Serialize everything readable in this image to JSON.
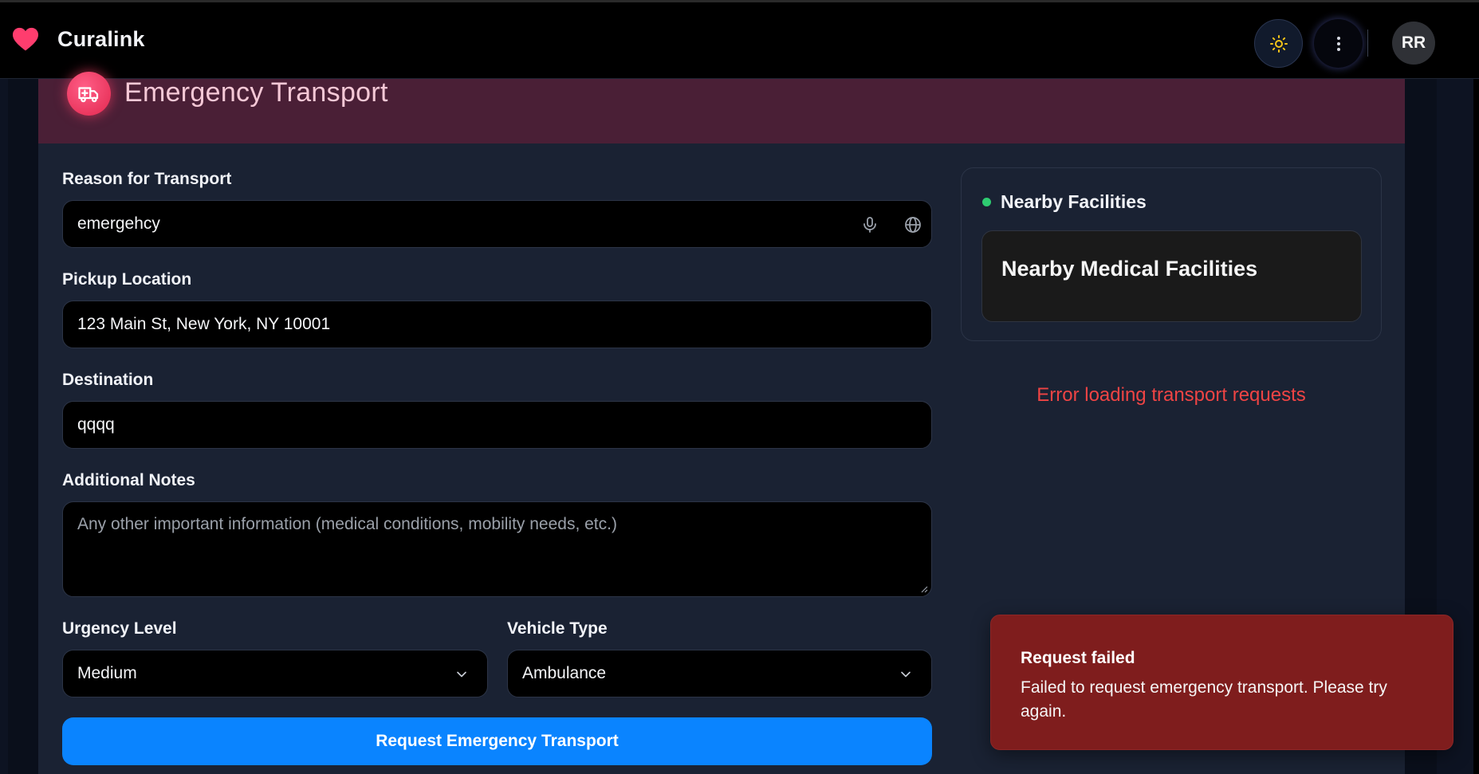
{
  "app": {
    "name": "Curalink"
  },
  "header": {
    "avatar_initials": "RR"
  },
  "page": {
    "title": "Emergency Transport"
  },
  "form": {
    "reason_label": "Reason for Transport",
    "reason_value": "emergehcy",
    "pickup_label": "Pickup Location",
    "pickup_value": "123 Main St, New York, NY 10001",
    "destination_label": "Destination",
    "destination_value": "qqqq",
    "notes_label": "Additional Notes",
    "notes_placeholder": "Any other important information (medical conditions, mobility needs, etc.)",
    "urgency_label": "Urgency Level",
    "urgency_value": "Medium",
    "vehicle_label": "Vehicle Type",
    "vehicle_value": "Ambulance",
    "submit_label": "Request Emergency Transport"
  },
  "facilities": {
    "title": "Nearby Facilities",
    "inner_title": "Nearby Medical Facilities",
    "status_color": "#2ecc71"
  },
  "error": {
    "message": "Error loading transport requests"
  },
  "toast": {
    "title": "Request failed",
    "message": "Failed to request emergency transport. Please try again."
  },
  "colors": {
    "accent": "#0a84ff",
    "brand": "#ff3d6e",
    "error": "#ef4444",
    "toast_bg": "#7f1d1d"
  },
  "icons": [
    "heart-icon",
    "sun-icon",
    "more-vertical-icon",
    "ambulance-icon",
    "microphone-icon",
    "globe-icon",
    "chevron-down-icon"
  ]
}
